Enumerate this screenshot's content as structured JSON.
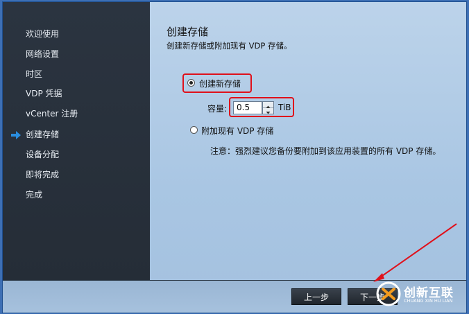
{
  "sidebar": {
    "items": [
      {
        "label": "欢迎使用"
      },
      {
        "label": "网络设置"
      },
      {
        "label": "时区"
      },
      {
        "label": "VDP 凭据"
      },
      {
        "label": "vCenter 注册"
      },
      {
        "label": "创建存储",
        "active": true
      },
      {
        "label": "设备分配"
      },
      {
        "label": "即将完成"
      },
      {
        "label": "完成"
      }
    ],
    "active_icon": "arrow-right-icon"
  },
  "main": {
    "title": "创建存储",
    "subtitle": "创建新存储或附加现有 VDP 存储。",
    "option_new": {
      "label": "创建新存储",
      "selected": true
    },
    "capacity": {
      "label": "容量:",
      "value": "0.5",
      "unit": "TiB"
    },
    "option_attach": {
      "label": "附加现有 VDP 存储",
      "selected": false
    },
    "note": "注意：强烈建议您备份要附加到该应用装置的所有 VDP 存储。"
  },
  "footer": {
    "prev_label": "上一步",
    "next_label": "下一步"
  },
  "watermark": {
    "text": "创新互联",
    "sub": "CHUANG XIN HU LIAN"
  },
  "colors": {
    "sidebar_bg": "#2b3440",
    "content_bg": "#bcd3ea",
    "highlight": "#e0101a",
    "arrow": "#2a8ee0"
  }
}
